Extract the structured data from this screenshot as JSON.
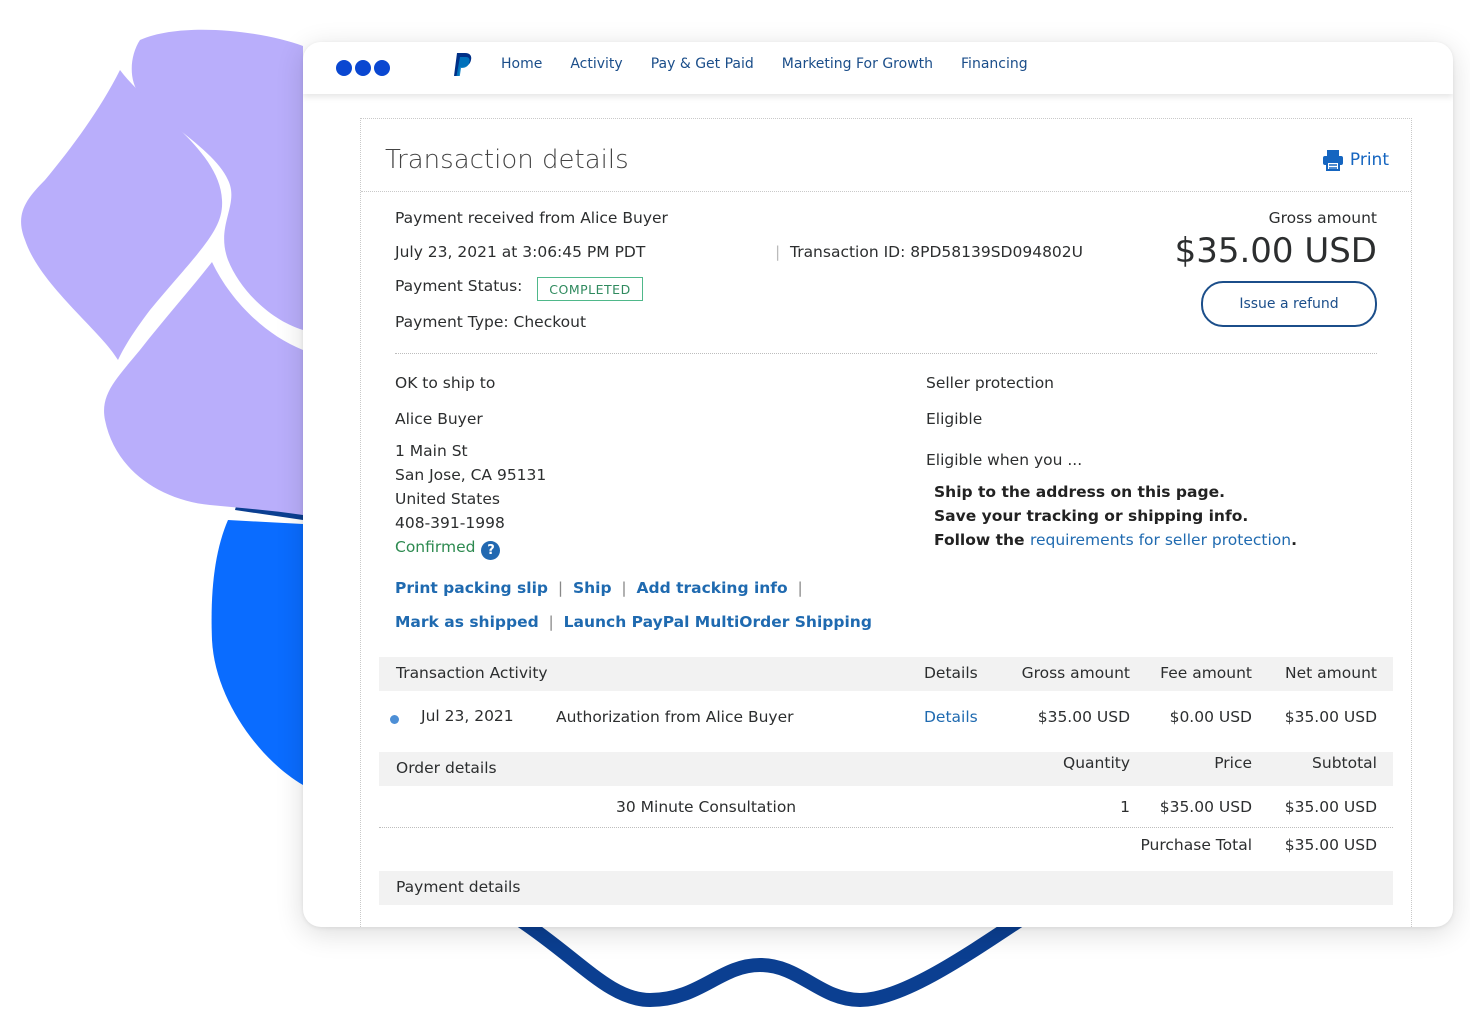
{
  "nav": {
    "items": [
      "Home",
      "Activity",
      "Pay & Get Paid",
      "Marketing For Growth",
      "Financing"
    ]
  },
  "header": {
    "title": "Transaction details",
    "print_label": "Print"
  },
  "summary": {
    "received_from": "Payment received from Alice Buyer",
    "date": "July 23, 2021 at 3:06:45 PM PDT",
    "transaction_id": "Transaction ID: 8PD58139SD094802U",
    "status_label": "Payment Status:",
    "status_value": "COMPLETED",
    "payment_type": "Payment Type: Checkout",
    "gross_label": "Gross amount",
    "gross_value": "$35.00 USD",
    "refund_button": "Issue a refund"
  },
  "shipping": {
    "heading": "OK to ship to",
    "name": "Alice Buyer",
    "address_lines": [
      "1 Main St",
      "San Jose, CA 95131",
      "United States",
      "408-391-1998"
    ],
    "confirmed": "Confirmed",
    "help_icon": "?",
    "links": [
      "Print packing slip",
      "Ship",
      "Add tracking info",
      "Mark as shipped",
      "Launch PayPal MultiOrder Shipping"
    ]
  },
  "protection": {
    "heading": "Seller protection",
    "status": "Eligible",
    "eligible_when": "Eligible when you ...",
    "items": [
      "Ship to the address on this page.",
      "Save your tracking or shipping info."
    ],
    "follow_prefix": "Follow the ",
    "follow_link": "requirements for seller protection",
    "follow_suffix": "."
  },
  "activity": {
    "headers": [
      "Transaction Activity",
      "Details",
      "Gross amount",
      "Fee amount",
      "Net amount"
    ],
    "rows": [
      {
        "date": "Jul 23, 2021",
        "description": "Authorization from Alice Buyer",
        "details": "Details",
        "gross": "$35.00 USD",
        "fee": "$0.00 USD",
        "net": "$35.00 USD"
      }
    ]
  },
  "order": {
    "headers": [
      "Order details",
      "Quantity",
      "Price",
      "Subtotal"
    ],
    "rows": [
      {
        "item": "30 Minute Consultation",
        "quantity": "1",
        "price": "$35.00 USD",
        "subtotal": "$35.00 USD"
      }
    ],
    "total_label": "Purchase Total",
    "total_value": "$35.00 USD"
  },
  "payment": {
    "heading": "Payment details"
  },
  "colors": {
    "nav_link": "#1b4e8a",
    "link": "#1f6ab0",
    "completed": "#2f8a5e",
    "deco_lavender": "#b9aefb",
    "deco_blue": "#0a6cff",
    "deco_navy": "#0b3f91"
  }
}
